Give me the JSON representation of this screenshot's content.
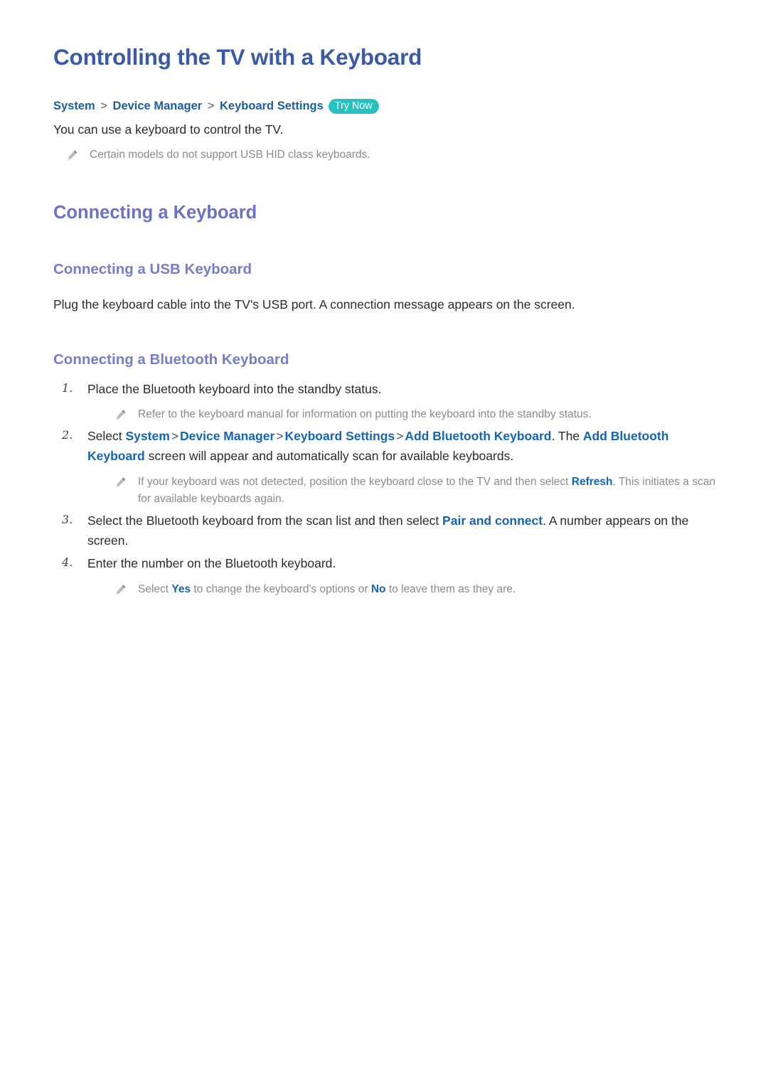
{
  "document": {
    "title": "Controlling the TV with a Keyboard"
  },
  "breadcrumb": {
    "crumbs": [
      "System",
      "Device Manager",
      "Keyboard Settings"
    ],
    "separator": ">",
    "badge_label": "Try Now"
  },
  "intro": {
    "paragraph": "You can use a keyboard to control the TV.",
    "note": "Certain models do not support USB HID class keyboards."
  },
  "sections": {
    "connecting_keyboard": {
      "heading": "Connecting a Keyboard"
    },
    "usb": {
      "heading": "Connecting a USB Keyboard",
      "paragraph": "Plug the keyboard cable into the TV's USB port. A connection message appears on the screen."
    },
    "bluetooth": {
      "heading": "Connecting a Bluetooth Keyboard",
      "steps": [
        {
          "num": "1.",
          "text": "Place the Bluetooth keyboard into the standby status.",
          "note": "Refer to the keyboard manual for information on putting the keyboard into the standby status."
        },
        {
          "num": "2.",
          "lead": "Select ",
          "path": [
            "System",
            "Device Manager",
            "Keyboard Settings",
            "Add Bluetooth Keyboard"
          ],
          "mid": ". The ",
          "emph": "Add Bluetooth Keyboard",
          "tail": " screen will appear and automatically scan for available keyboards.",
          "note_pre": "If your keyboard was not detected, position the keyboard close to the TV and then select ",
          "note_link": "Refresh",
          "note_post": ". This initiates a scan for available keyboards again."
        },
        {
          "num": "3.",
          "lead": "Select the Bluetooth keyboard from the scan list and then select ",
          "link": "Pair and connect",
          "tail": ". A number appears on the screen."
        },
        {
          "num": "4.",
          "text": "Enter the number on the Bluetooth keyboard.",
          "note_pre": "Select ",
          "note_link_yes": "Yes",
          "note_mid": " to change the keyboard's options or ",
          "note_link_no": "No",
          "note_post": " to leave them as they are."
        }
      ]
    }
  },
  "icons": {
    "note": "pencil-icon"
  },
  "colors": {
    "title_blue": "#3a5aa8",
    "heading_purple": "#6b72c6",
    "subheading_purple": "#767dcb",
    "link_blue": "#1365b5",
    "breadcrumb_blue": "#1a5fa8",
    "badge_teal": "#27c1c1",
    "note_gray": "#8a8a8a",
    "body_text": "#2b2b2b"
  }
}
